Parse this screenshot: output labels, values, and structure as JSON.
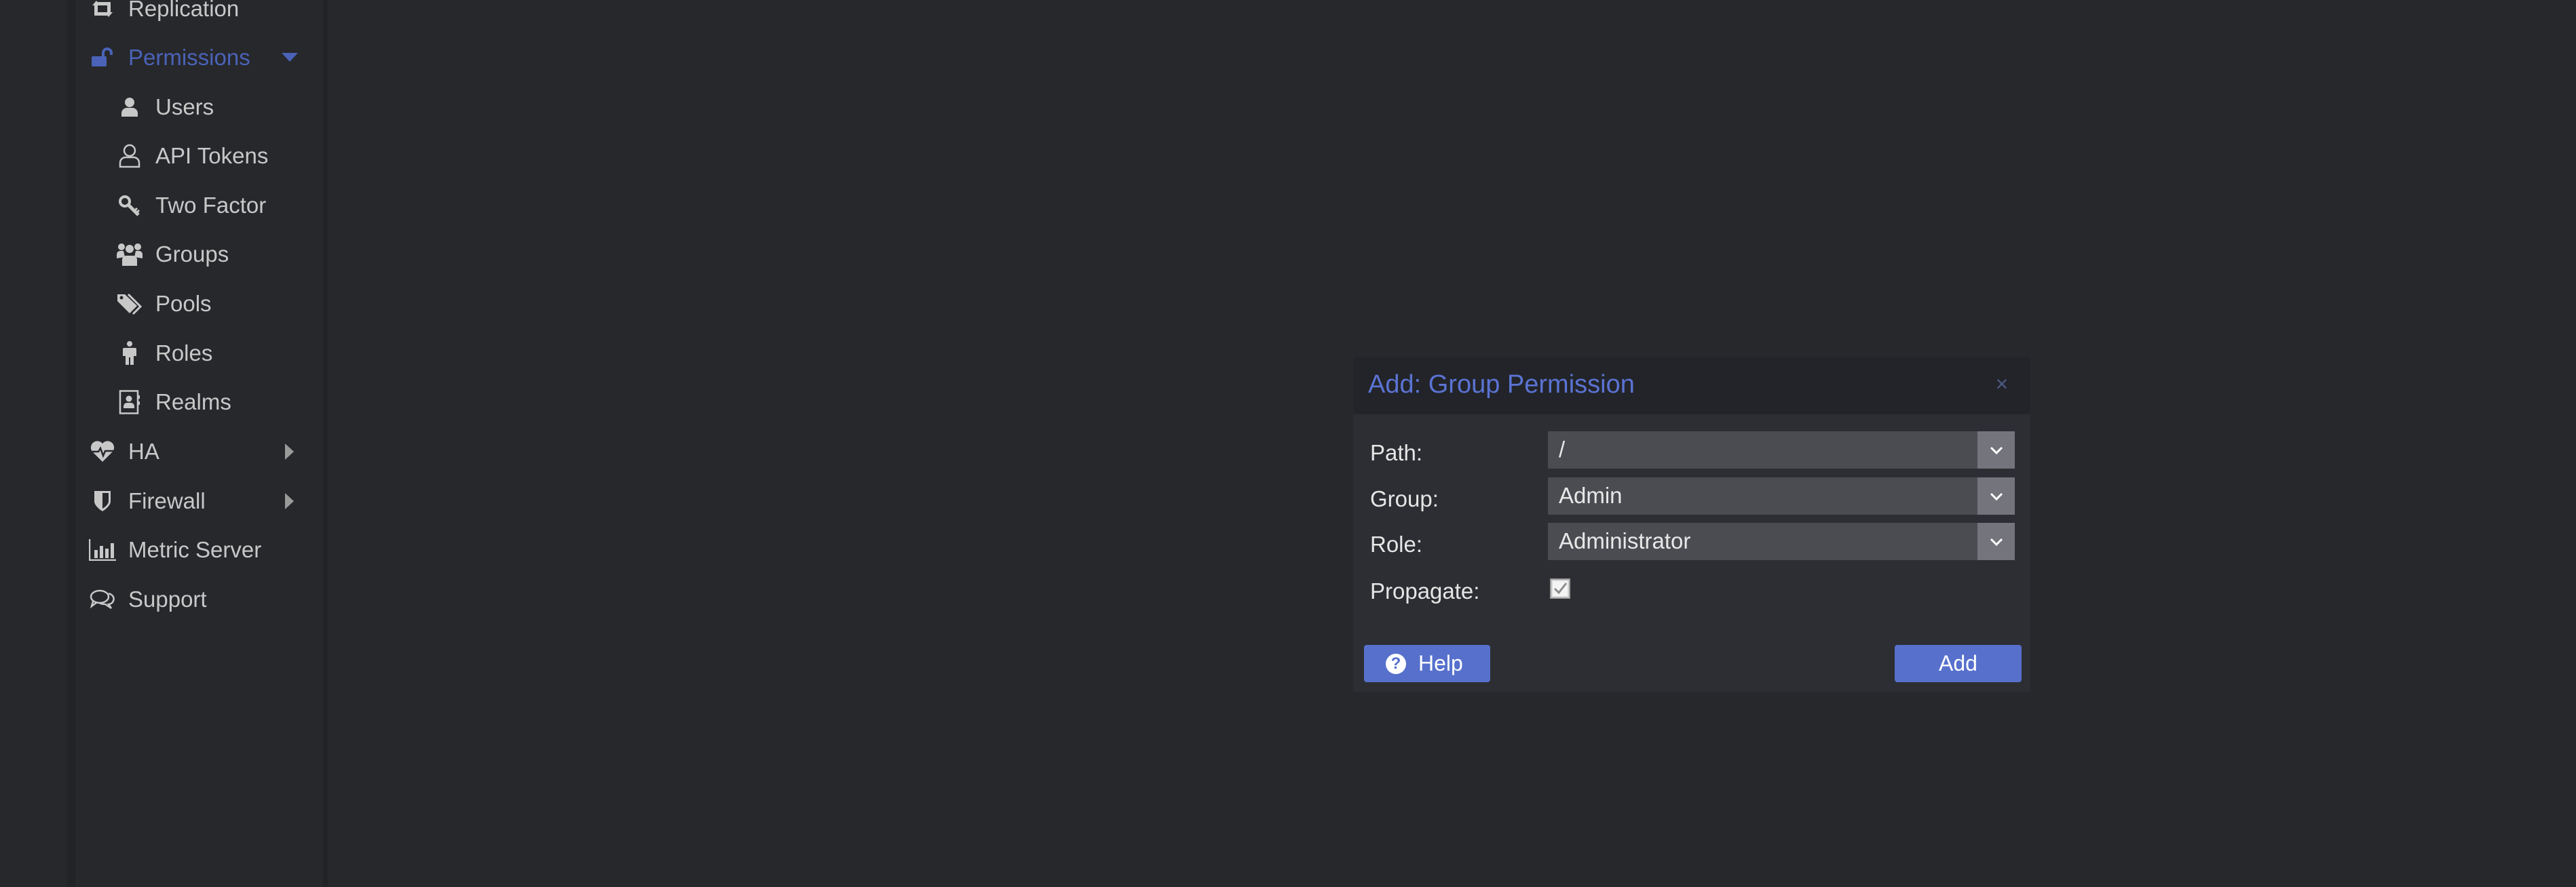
{
  "sidebar": {
    "items": [
      {
        "label": "Replication",
        "icon": "retweet-icon",
        "level": 1
      },
      {
        "label": "Permissions",
        "icon": "unlock-icon",
        "level": 1,
        "active": true,
        "expanded": true
      },
      {
        "label": "Users",
        "icon": "user-icon",
        "level": 2
      },
      {
        "label": "API Tokens",
        "icon": "user-outline-icon",
        "level": 2
      },
      {
        "label": "Two Factor",
        "icon": "key-icon",
        "level": 2
      },
      {
        "label": "Groups",
        "icon": "users-icon",
        "level": 2
      },
      {
        "label": "Pools",
        "icon": "tags-icon",
        "level": 2
      },
      {
        "label": "Roles",
        "icon": "male-icon",
        "level": 2
      },
      {
        "label": "Realms",
        "icon": "address-book-icon",
        "level": 2
      },
      {
        "label": "HA",
        "icon": "heartbeat-icon",
        "level": 1,
        "expandable": true
      },
      {
        "label": "Firewall",
        "icon": "shield-icon",
        "level": 1,
        "expandable": true
      },
      {
        "label": "Metric Server",
        "icon": "bar-chart-icon",
        "level": 1
      },
      {
        "label": "Support",
        "icon": "comments-icon",
        "level": 1
      }
    ]
  },
  "dialog": {
    "title": "Add: Group Permission",
    "close_label": "×",
    "fields": {
      "path": {
        "label": "Path:",
        "value": "/"
      },
      "group": {
        "label": "Group:",
        "value": "Admin"
      },
      "role": {
        "label": "Role:",
        "value": "Administrator"
      },
      "propagate": {
        "label": "Propagate:",
        "checked": true
      }
    },
    "help_label": "Help",
    "add_label": "Add"
  },
  "colors": {
    "accent": "#5670cc",
    "active_nav": "#4a63b8",
    "title": "#5b73d3",
    "background": "#27282c"
  }
}
